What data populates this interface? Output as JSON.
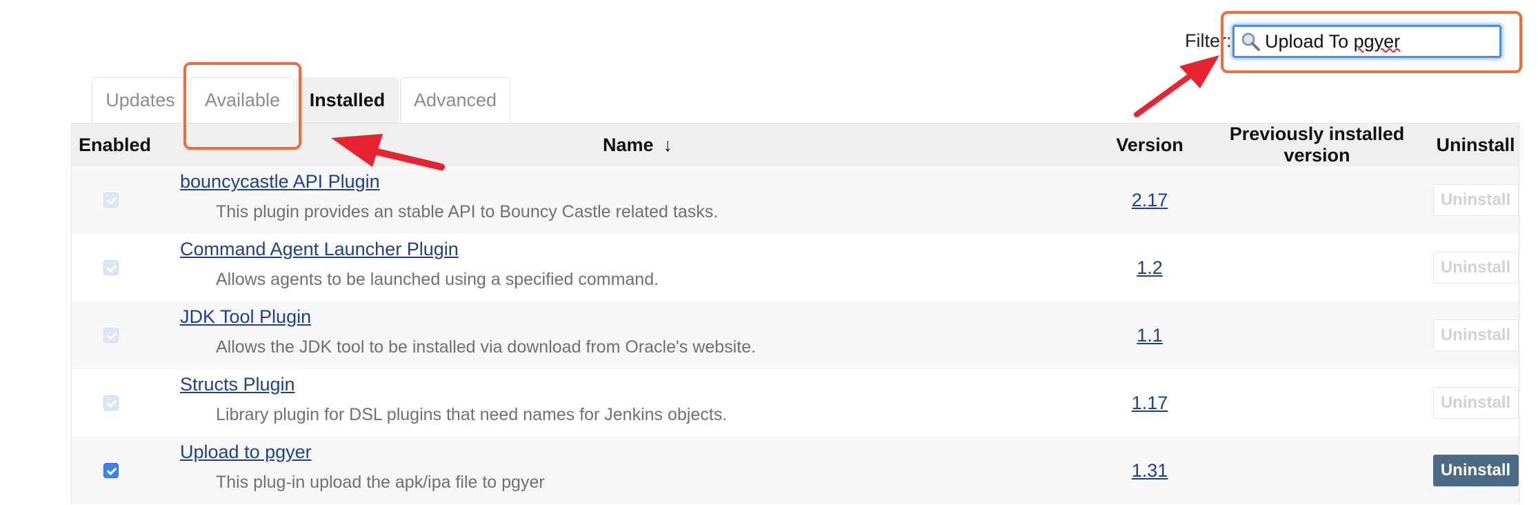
{
  "filter": {
    "label": "Filter:",
    "value_prefix": "Upload To ",
    "value_squiggle": "pgyer",
    "icon": "magnifier-icon"
  },
  "tabs": [
    {
      "label": "Updates",
      "active": false
    },
    {
      "label": "Available",
      "active": false
    },
    {
      "label": "Installed",
      "active": true
    },
    {
      "label": "Advanced",
      "active": false
    }
  ],
  "table": {
    "headers": {
      "enabled": "Enabled",
      "name": "Name",
      "sort_arrow": "↓",
      "version": "Version",
      "previous_version": "Previously installed version",
      "uninstall": "Uninstall"
    },
    "rows": [
      {
        "name": "bouncycastle API Plugin",
        "description": "This plugin provides an stable API to Bouncy Castle related tasks.",
        "version": "2.17",
        "previous_version": "",
        "uninstall_label": "Uninstall",
        "enabled": true,
        "editable": false
      },
      {
        "name": "Command Agent Launcher Plugin",
        "description": "Allows agents to be launched using a specified command.",
        "version": "1.2",
        "previous_version": "",
        "uninstall_label": "Uninstall",
        "enabled": true,
        "editable": false
      },
      {
        "name": "JDK Tool Plugin",
        "description": "Allows the JDK tool to be installed via download from Oracle's website.",
        "version": "1.1",
        "previous_version": "",
        "uninstall_label": "Uninstall",
        "enabled": true,
        "editable": false
      },
      {
        "name": "Structs Plugin",
        "description": "Library plugin for DSL plugins that need names for Jenkins objects.",
        "version": "1.17",
        "previous_version": "",
        "uninstall_label": "Uninstall",
        "enabled": true,
        "editable": false
      },
      {
        "name": "Upload to pgyer",
        "description": "This plug-in upload the apk/ipa file to pgyer",
        "version": "1.31",
        "previous_version": "",
        "uninstall_label": "Uninstall",
        "enabled": true,
        "editable": true
      }
    ]
  },
  "annotations": {
    "color": "#f26b3a",
    "arrow_color": "#e8232f"
  }
}
